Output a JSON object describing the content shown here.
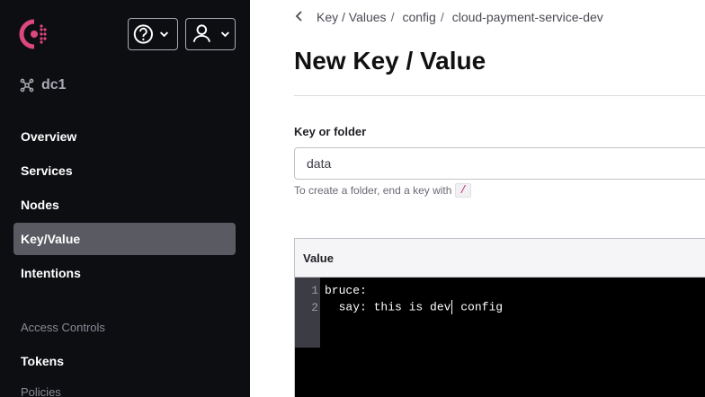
{
  "sidebar": {
    "datacenter": "dc1",
    "items": [
      {
        "label": "Overview"
      },
      {
        "label": "Services"
      },
      {
        "label": "Nodes"
      },
      {
        "label": "Key/Value"
      },
      {
        "label": "Intentions"
      }
    ],
    "access_section": "Access Controls",
    "access_items": [
      {
        "label": "Tokens"
      },
      {
        "label": "Policies"
      }
    ],
    "active_item": "Key/Value"
  },
  "breadcrumb": {
    "items": [
      "Key / Values",
      "config",
      "cloud-payment-service-dev"
    ],
    "separator": "/"
  },
  "page": {
    "title": "New Key / Value"
  },
  "form": {
    "key_label": "Key or folder",
    "key_value": "data",
    "hint_text": "To create a folder, end a key with",
    "hint_code": "/",
    "value_label": "Value",
    "editor_lines": [
      {
        "num": "1",
        "text": "bruce:"
      },
      {
        "num": "2",
        "before_caret": "  say: this is dev",
        "after_caret": " config"
      }
    ]
  },
  "colors": {
    "sidebar_bg": "#0d0e12",
    "brand": "#dc477d",
    "active_bg": "#5a5a63",
    "editor_bg": "#000000"
  }
}
